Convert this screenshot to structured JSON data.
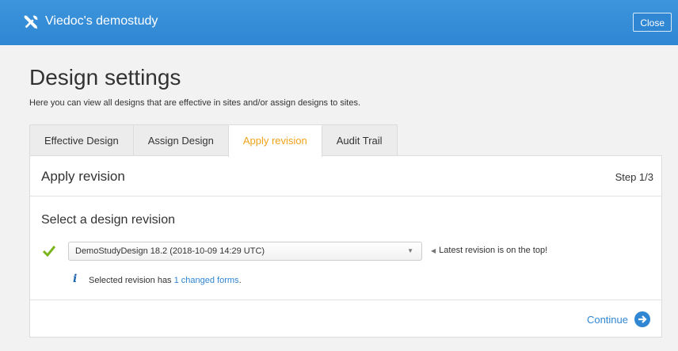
{
  "header": {
    "app_title": "Viedoc's demostudy",
    "close_label": "Close",
    "icon": "tools-icon"
  },
  "page": {
    "title": "Design settings",
    "description": "Here you can view all designs that are effective in sites and/or assign designs to sites."
  },
  "tabs": [
    {
      "label": "Effective Design",
      "active": false
    },
    {
      "label": "Assign Design",
      "active": false
    },
    {
      "label": "Apply revision",
      "active": true
    },
    {
      "label": "Audit Trail",
      "active": false
    }
  ],
  "panel": {
    "title": "Apply revision",
    "step": "Step 1/3",
    "section_title": "Select a design revision",
    "selected_revision": "DemoStudyDesign 18.2 (2018-10-09 14:29 UTC)",
    "hint": "Latest revision is on the top!",
    "info_prefix": "Selected revision has ",
    "info_link": "1 changed forms",
    "info_suffix": ".",
    "continue_label": "Continue"
  },
  "colors": {
    "header_blue": "#2f86d2",
    "active_tab": "#f0a21a",
    "link_blue": "#2f86d2",
    "check_green": "#7ab51d"
  }
}
